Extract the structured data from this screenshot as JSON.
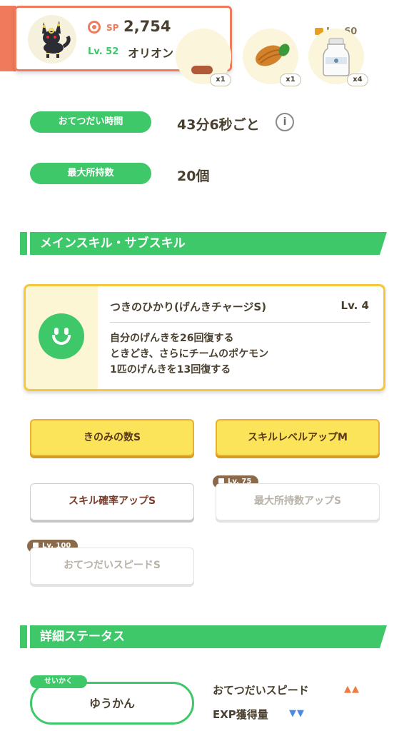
{
  "header": {
    "sp_label": "SP",
    "sp_value": "2,754",
    "level": "Lv. 52",
    "name": "オリオン"
  },
  "ingredients": [
    {
      "qty": "x1",
      "icon": "ingredient-icon"
    },
    {
      "qty": "x1",
      "icon": "cacao-icon"
    },
    {
      "qty": "x4",
      "icon": "milk-bottle-icon",
      "lock_level": "Lv. 60"
    }
  ],
  "info": {
    "help_time_label": "おてつだい時間",
    "help_time_value": "43分6秒ごと",
    "info_icon": "i",
    "max_carry_label": "最大所持数",
    "max_carry_value": "20個"
  },
  "skills_section": {
    "title": "メインスキル・サブスキル"
  },
  "main_skill": {
    "name": "つきのひかり(げんきチャージS)",
    "level": "Lv. 4",
    "desc_1": "自分のげんきを26回復する",
    "desc_2": "ときどき、さらにチームのポケモン",
    "desc_3": "1匹のげんきを13回復する"
  },
  "sub_skills": [
    {
      "label": "きのみの数S",
      "style": "gold"
    },
    {
      "label": "スキルレベルアップM",
      "style": "gold"
    },
    {
      "label": "スキル確率アップS",
      "style": "white"
    },
    {
      "label": "最大所持数アップS",
      "style": "locked",
      "lock": "Lv. 75"
    },
    {
      "label": "おてつだいスピードS",
      "style": "locked",
      "lock": "Lv. 100"
    }
  ],
  "details_section": {
    "title": "詳細ステータス"
  },
  "nature": {
    "tag": "せいかく",
    "value": "ゆうかん",
    "up_label": "おてつだいスピード",
    "up_arrows": "▲▲",
    "down_label": "EXP獲得量",
    "down_arrows": "▼▼"
  },
  "colors": {
    "accent_green": "#3ec86a",
    "header_orange": "#f07a5c",
    "gold": "#fbe35a"
  }
}
